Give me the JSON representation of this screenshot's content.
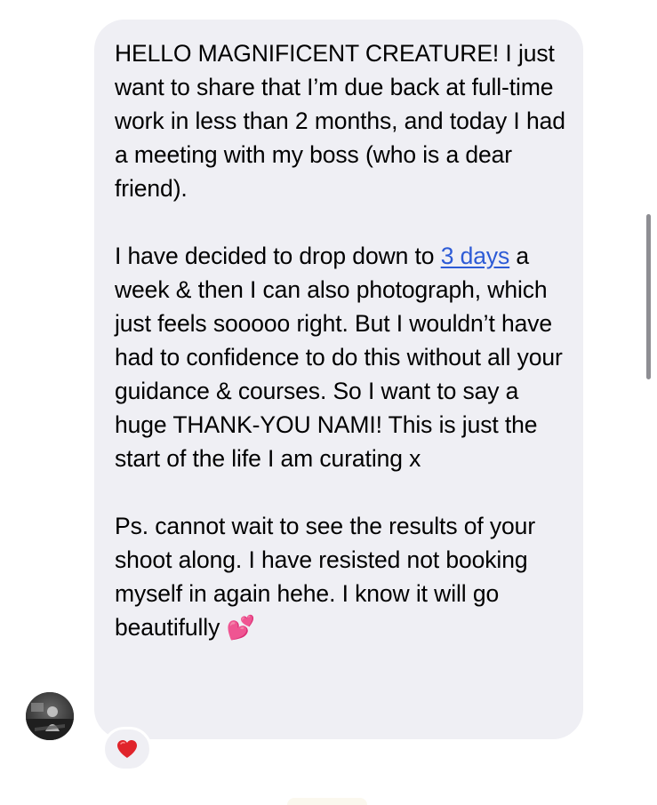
{
  "message": {
    "p1": "HELLO MAGNIFICENT CREATURE! I just want to share that I’m due back at full-time work in less than 2 months, and today I had a meeting with my boss (who is a dear friend).",
    "p2_before": "I have decided to drop down to ",
    "p2_link": "3 days",
    "p2_after": " a week & then I can also photograph, which just feels sooooo right. But I wouldn’t have had to confidence to do this without all your guidance & courses. So I want to say a huge THANK-YOU NAMI! This is just the start of the life I am curating x",
    "p3_text": "Ps. cannot wait to see the results of your shoot along. I have resisted not booking myself in again hehe. I know it will go beautifully ",
    "p3_emoji": "💕"
  },
  "reaction": {
    "icon": "heart-icon",
    "color": "#e0242b"
  },
  "colors": {
    "bubble_bg": "#efeff4",
    "link": "#2d5bd6",
    "scrollbar": "#8e8e93"
  }
}
